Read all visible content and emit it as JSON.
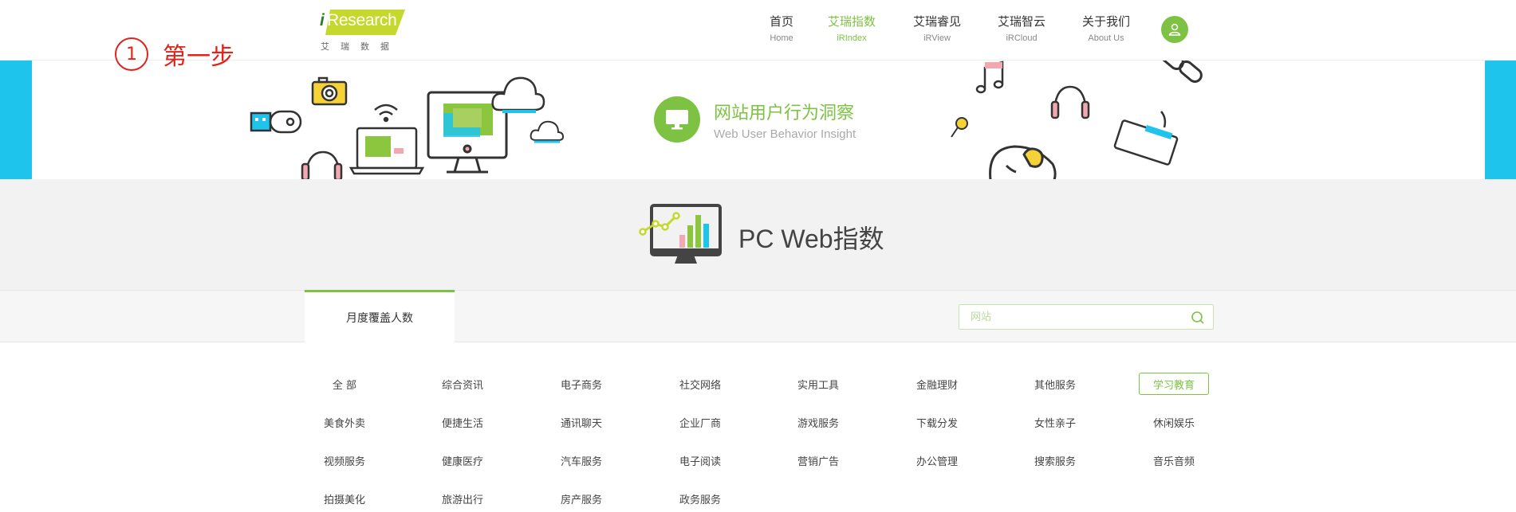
{
  "header": {
    "logo_text": "Research",
    "logo_i": "i",
    "logo_sub": "艾瑞数据",
    "nav": [
      {
        "cn": "首页",
        "en": "Home",
        "active": false
      },
      {
        "cn": "艾瑞指数",
        "en": "iRIndex",
        "active": true
      },
      {
        "cn": "艾瑞睿见",
        "en": "iRView",
        "active": false
      },
      {
        "cn": "艾瑞智云",
        "en": "iRCloud",
        "active": false
      },
      {
        "cn": "关于我们",
        "en": "About Us",
        "active": false
      }
    ],
    "user_icon": "user-icon"
  },
  "annotation": {
    "number": "1",
    "text": "第一步"
  },
  "banner": {
    "title": "网站用户行为洞察",
    "subtitle": "Web User Behavior Insight",
    "icon": "monitor-icon"
  },
  "main": {
    "page_title": "PC Web指数",
    "tab_label": "月度覆盖人数",
    "search_placeholder": "网站"
  },
  "categories": [
    [
      "全 部",
      "综合资讯",
      "电子商务",
      "社交网络",
      "实用工具",
      "金融理财",
      "其他服务",
      "学习教育"
    ],
    [
      "美食外卖",
      "便捷生活",
      "通讯聊天",
      "企业厂商",
      "游戏服务",
      "下载分发",
      "女性亲子",
      "休闲娱乐"
    ],
    [
      "视频服务",
      "健康医疗",
      "汽车服务",
      "电子阅读",
      "营销广告",
      "办公管理",
      "搜索服务",
      "音乐音频"
    ],
    [
      "拍摄美化",
      "旅游出行",
      "房产服务",
      "政务服务"
    ]
  ],
  "active_category": "学习教育",
  "colors": {
    "accent": "#7dc242",
    "side": "#1fc4ec",
    "annotation": "#e0241b"
  }
}
